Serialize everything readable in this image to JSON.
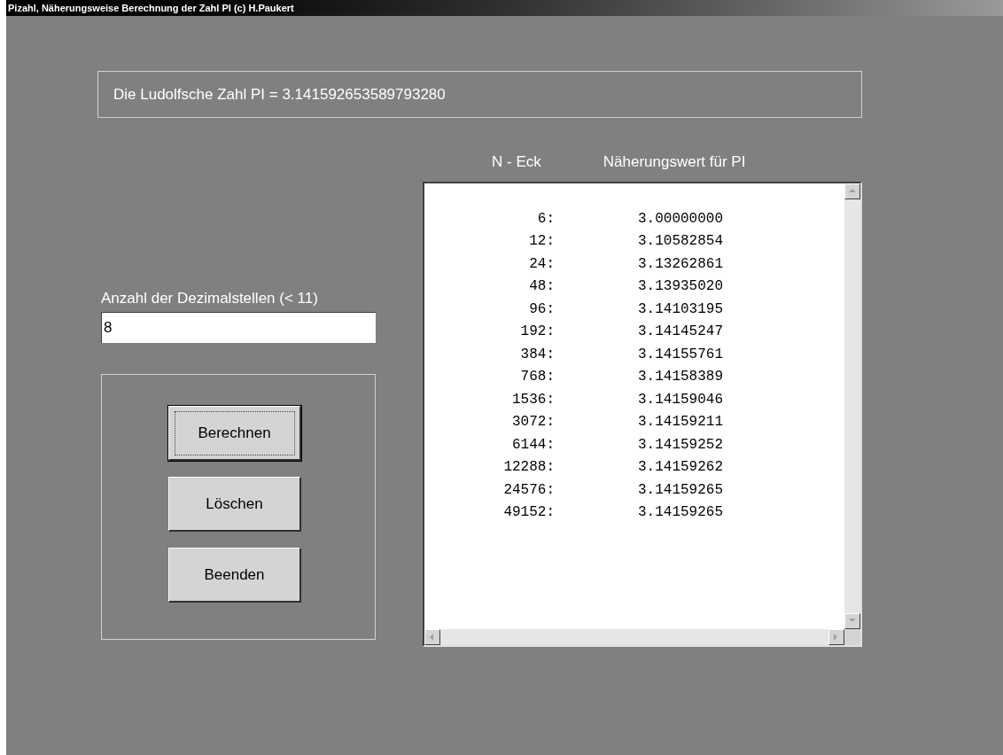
{
  "window": {
    "title": "Pizahl, Näherungsweise Berechnung der Zahl PI (c) H.Paukert"
  },
  "pi_display": "Die Ludolfsche Zahl PI = 3.141592653589793280",
  "decimals": {
    "label": "Anzahl der Dezimalstellen (< 11)",
    "value": "8"
  },
  "buttons": [
    {
      "label": "Berechnen",
      "focused": true
    },
    {
      "label": "Löschen",
      "focused": false
    },
    {
      "label": "Beenden",
      "focused": false
    }
  ],
  "table": {
    "columns": [
      "N - Eck",
      "Näherungswert für PI"
    ],
    "rows": [
      {
        "n": "6:",
        "value": "3.00000000"
      },
      {
        "n": "12:",
        "value": "3.10582854"
      },
      {
        "n": "24:",
        "value": "3.13262861"
      },
      {
        "n": "48:",
        "value": "3.13935020"
      },
      {
        "n": "96:",
        "value": "3.14103195"
      },
      {
        "n": "192:",
        "value": "3.14145247"
      },
      {
        "n": "384:",
        "value": "3.14155761"
      },
      {
        "n": "768:",
        "value": "3.14158389"
      },
      {
        "n": "1536:",
        "value": "3.14159046"
      },
      {
        "n": "3072:",
        "value": "3.14159211"
      },
      {
        "n": "6144:",
        "value": "3.14159252"
      },
      {
        "n": "12288:",
        "value": "3.14159262"
      },
      {
        "n": "24576:",
        "value": "3.14159265"
      },
      {
        "n": "49152:",
        "value": "3.14159265"
      }
    ]
  }
}
